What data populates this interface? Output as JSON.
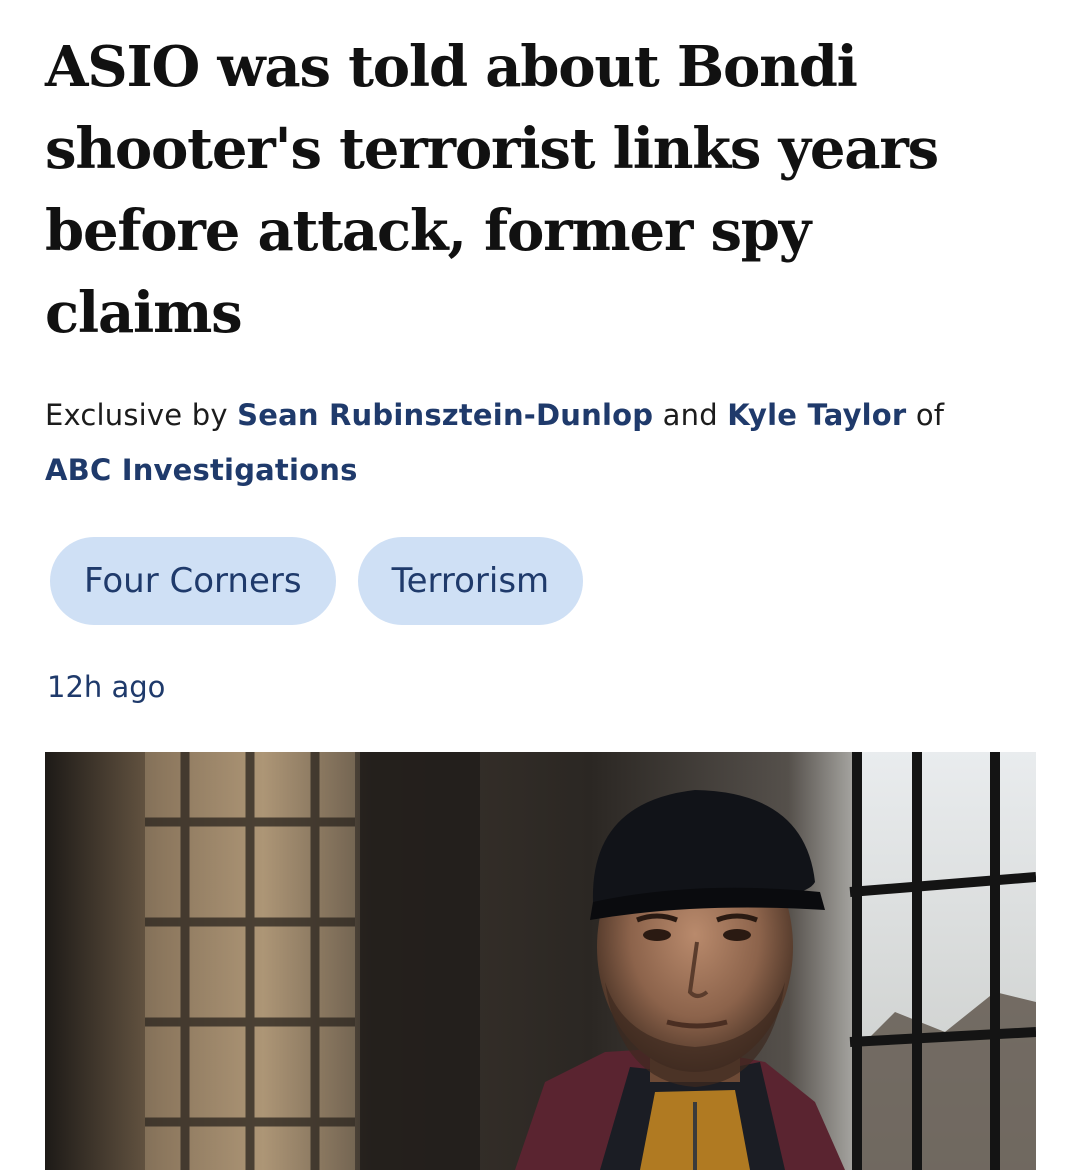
{
  "article": {
    "headline": "ASIO was told about Bondi shooter's terrorist links years before attack, former spy claims",
    "byline": {
      "prefix": "Exclusive by ",
      "author1": "Sean Rubinsztein-Dunlop",
      "conjunction": " and ",
      "author2": "Kyle Taylor",
      "of": " of ",
      "organisation": "ABC Investigations"
    },
    "tags": [
      "Four Corners",
      "Terrorism"
    ],
    "timestamp": "12h ago",
    "hero_image": {
      "subject": "man-in-black-cap-by-window"
    }
  },
  "colors": {
    "link": "#1f3a6b",
    "tag_bg": "#cfe0f5",
    "headline": "#111111"
  }
}
